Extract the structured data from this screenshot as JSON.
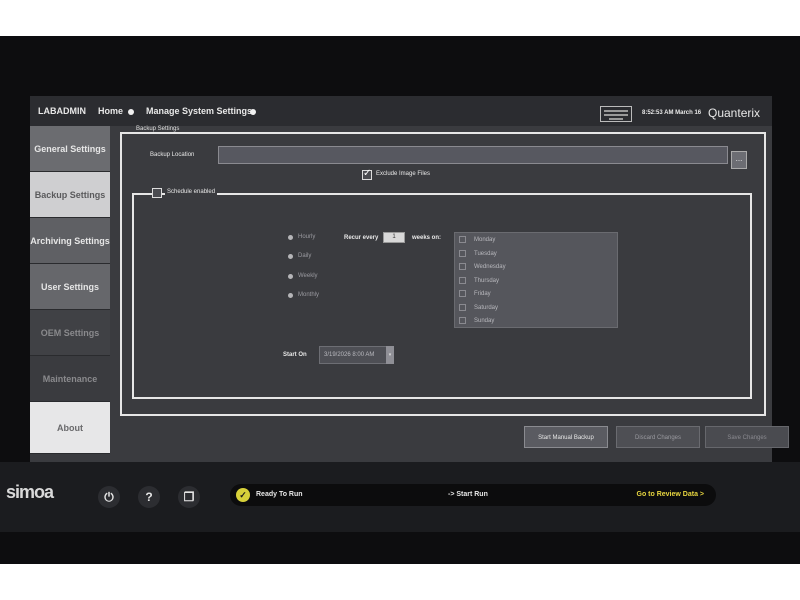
{
  "topbar": {
    "user": "LABADMIN",
    "home": "Home",
    "breadcrumb": "Manage System Settings",
    "time": "8:52:53 AM  March 16",
    "brand": "Quanterix"
  },
  "sidebar": {
    "items": [
      {
        "label": "General Settings"
      },
      {
        "label": "Backup Settings"
      },
      {
        "label": "Archiving Settings"
      },
      {
        "label": "User Settings"
      },
      {
        "label": "OEM Settings"
      },
      {
        "label": "Maintenance"
      },
      {
        "label": "About"
      }
    ]
  },
  "backup": {
    "legend": "Backup Settings",
    "location_label": "Backup Location",
    "location_value": "",
    "browse_label": "...",
    "exclude_label": "Exclude Image Files",
    "exclude_checked": true
  },
  "schedule": {
    "enabled_label": "Schedule enabled",
    "enabled": false,
    "frequencies": [
      "Hourly",
      "Daily",
      "Weekly",
      "Monthly"
    ],
    "recur_label": "Recur every",
    "recur_value": "1",
    "weeks_label": "weeks on:",
    "days": [
      "Monday",
      "Tuesday",
      "Wednesday",
      "Thursday",
      "Friday",
      "Saturday",
      "Sunday"
    ],
    "start_label": "Start On",
    "start_value": "3/19/2026 8:00 AM"
  },
  "buttons": {
    "start_backup": "Start Manual Backup",
    "discard": "Discard Changes",
    "save": "Save Changes"
  },
  "statusbar": {
    "logo": "simoa",
    "ready": "Ready To Run",
    "start_run": "-> Start Run",
    "review": "Go to Review Data >"
  }
}
